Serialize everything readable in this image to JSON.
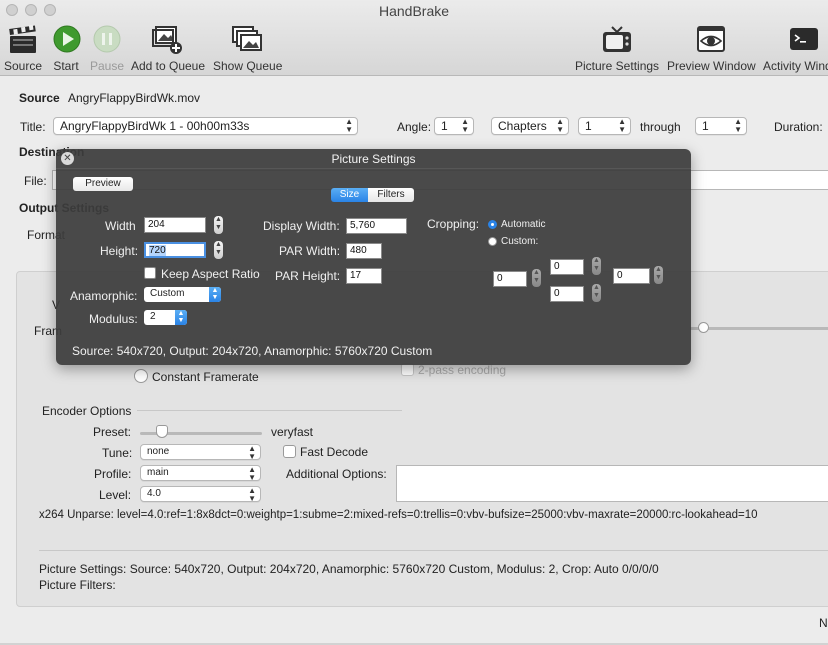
{
  "window": {
    "title": "HandBrake"
  },
  "toolbar": {
    "source": "Source",
    "start": "Start",
    "pause": "Pause",
    "add_to_queue": "Add to Queue",
    "show_queue": "Show Queue",
    "picture_settings": "Picture Settings",
    "preview_window": "Preview Window",
    "activity_window": "Activity Window"
  },
  "source": {
    "label": "Source",
    "value": "AngryFlappyBirdWk.mov"
  },
  "title_row": {
    "title_label": "Title:",
    "title_value": "AngryFlappyBirdWk 1 - 00h00m33s",
    "angle_label": "Angle:",
    "angle_value": "1",
    "range_type": "Chapters",
    "range_start": "1",
    "through_label": "through",
    "range_end": "1",
    "duration_label": "Duration:"
  },
  "destination": {
    "label": "Destination",
    "file_label": "File:"
  },
  "output": {
    "label": "Output Settings",
    "format_label": "Format"
  },
  "video": {
    "codec_label_partial": "V",
    "framerate_label_partial": "Fram",
    "constant_framerate": "Constant Framerate",
    "two_pass": "2-pass encoding"
  },
  "encoder": {
    "section_label": "Encoder Options",
    "preset_label": "Preset:",
    "preset_value": "veryfast",
    "preset_level": 0.18,
    "tune_label": "Tune:",
    "tune_value": "none",
    "fast_decode": "Fast Decode",
    "profile_label": "Profile:",
    "profile_value": "main",
    "additional_label": "Additional Options:",
    "level_label": "Level:",
    "level_value": "4.0",
    "unparse": "x264 Unparse: level=4.0:ref=1:8x8dct=0:weightp=1:subme=2:mixed-refs=0:trellis=0:vbv-bufsize=25000:vbv-maxrate=20000:rc-lookahead=10"
  },
  "summary": {
    "picture_settings": "Picture Settings: Source: 540x720, Output: 204x720, Anamorphic: 5760x720 Custom, Modulus: 2, Crop: Auto 0/0/0/0",
    "picture_filters": "Picture Filters:"
  },
  "footer": {
    "partial": "N"
  },
  "picture_hud": {
    "title": "Picture Settings",
    "close_glyph": "✕",
    "preview_button": "Preview",
    "tab_size": "Size",
    "tab_filters": "Filters",
    "width_label": "Width",
    "width_value": "204",
    "height_label": "Height:",
    "height_value": "720",
    "keep_aspect": "Keep Aspect Ratio",
    "anamorphic_label": "Anamorphic:",
    "anamorphic_value": "Custom",
    "modulus_label": "Modulus:",
    "modulus_value": "2",
    "display_width_label": "Display Width:",
    "display_width_value": "5,760",
    "par_width_label": "PAR Width:",
    "par_width_value": "480",
    "par_height_label": "PAR Height:",
    "par_height_value": "17",
    "cropping_label": "Cropping:",
    "crop_automatic": "Automatic",
    "crop_custom": "Custom:",
    "crop_top": "0",
    "crop_bottom": "0",
    "crop_left": "0",
    "crop_right": "0",
    "status": "Source: 540x720, Output: 204x720, Anamorphic: 5760x720 Custom"
  }
}
